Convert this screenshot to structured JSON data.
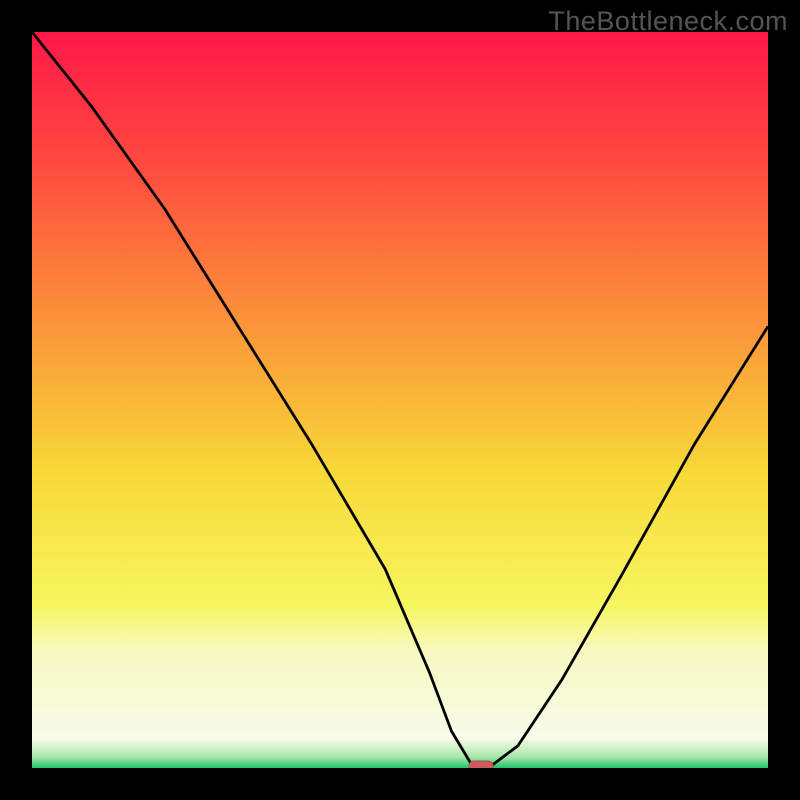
{
  "watermark": "TheBottleneck.com",
  "colors": {
    "black": "#000000",
    "curve": "#000000",
    "marker_fill": "#cd5a5c",
    "marker_stroke": "#b84b4d",
    "gradient_stops": [
      {
        "offset": 0.0,
        "color": "#ff1848"
      },
      {
        "offset": 0.18,
        "color": "#ff4a3f"
      },
      {
        "offset": 0.4,
        "color": "#fb953a"
      },
      {
        "offset": 0.6,
        "color": "#f8d938"
      },
      {
        "offset": 0.78,
        "color": "#f6f660"
      },
      {
        "offset": 0.84,
        "color": "#f7f9c0"
      },
      {
        "offset": 0.96,
        "color": "#f7fbe9"
      },
      {
        "offset": 0.985,
        "color": "#a8e8a8"
      },
      {
        "offset": 1.0,
        "color": "#1ec46b"
      }
    ]
  },
  "chart_data": {
    "type": "line",
    "title": "",
    "xlabel": "",
    "ylabel": "",
    "xlim": [
      0,
      100
    ],
    "ylim": [
      0,
      100
    ],
    "series": [
      {
        "name": "bottleneck-curve",
        "x": [
          0,
          8,
          18,
          28,
          38,
          48,
          54,
          57,
          60,
          62,
          66,
          72,
          80,
          90,
          100
        ],
        "values": [
          100,
          90,
          76,
          60,
          44,
          27,
          13,
          5,
          0,
          0,
          3,
          12,
          26,
          44,
          60
        ]
      }
    ],
    "marker": {
      "x": 61,
      "y": 0,
      "label": "optimal-point"
    }
  }
}
